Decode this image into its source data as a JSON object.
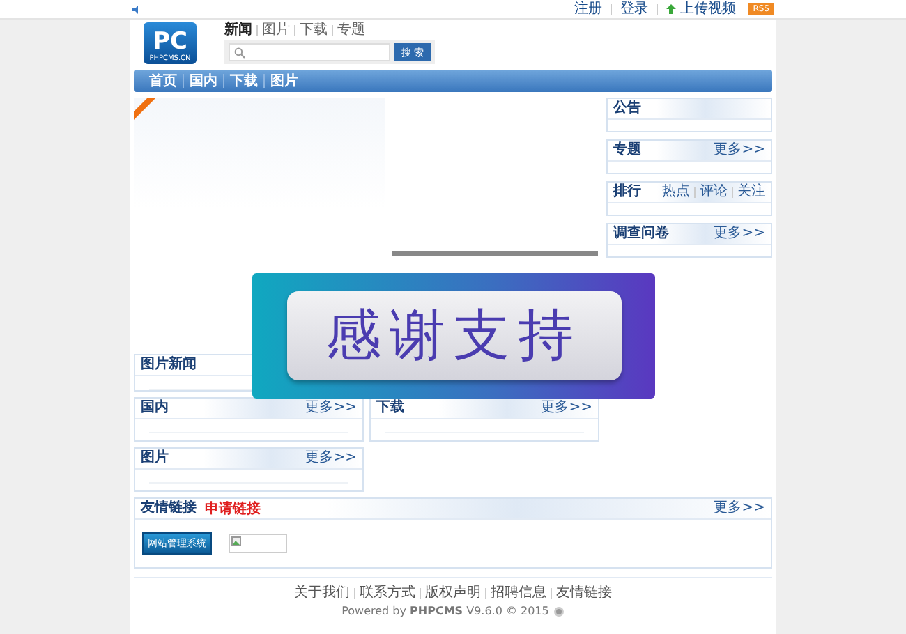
{
  "top_bar": {
    "links": [
      {
        "label": "注册",
        "kind": "text"
      },
      {
        "label": "登录",
        "kind": "text"
      },
      {
        "label": "上传视频",
        "kind": "upload"
      }
    ],
    "rss": "RSS"
  },
  "header": {
    "logo": {
      "mark": "PC",
      "caption": "PHPCMS.CN"
    },
    "search_tabs": [
      {
        "label": "新闻",
        "selected": true
      },
      {
        "label": "图片",
        "selected": false
      },
      {
        "label": "下载",
        "selected": false
      },
      {
        "label": "专题",
        "selected": false
      }
    ],
    "search_button": "搜 索"
  },
  "nav": [
    {
      "label": "首页"
    },
    {
      "label": "国内"
    },
    {
      "label": "下载"
    },
    {
      "label": "图片"
    }
  ],
  "left_boxes": [
    {
      "title": "图片新闻",
      "kind": "wide"
    },
    {
      "title": "国内",
      "more": "更多>>",
      "kind": "half"
    },
    {
      "title": "下载",
      "more": "更多>>",
      "kind": "half"
    },
    {
      "title": "图片",
      "more": "更多>>",
      "kind": "half"
    }
  ],
  "right_boxes": [
    {
      "title": "公告"
    },
    {
      "title": "专题",
      "more": "更多>>"
    },
    {
      "title": "排行",
      "tabs": [
        "热点",
        "评论",
        "关注"
      ]
    },
    {
      "title": "调查问卷",
      "more": "更多>>"
    }
  ],
  "friend_links": {
    "title": "友情链接",
    "apply": "申请链接",
    "more": "更多>>",
    "links": [
      {
        "kind": "banner",
        "label": "网站管理系统"
      },
      {
        "kind": "broken"
      }
    ]
  },
  "footer": {
    "links": [
      "关于我们",
      "联系方式",
      "版权声明",
      "招聘信息",
      "友情链接"
    ],
    "powered": "Powered by **PHPCMS** V9.6.0 © 2015"
  },
  "float_banner": {
    "text": "感谢支持"
  }
}
